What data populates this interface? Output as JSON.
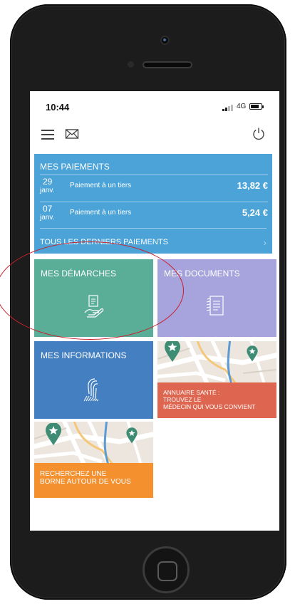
{
  "status_bar": {
    "time": "10:44",
    "network": "4G"
  },
  "payments": {
    "title": "MES PAIEMENTS",
    "items": [
      {
        "day": "29",
        "month": "janv.",
        "label": "Paiement à un tiers",
        "amount": "13,82 €"
      },
      {
        "day": "07",
        "month": "janv.",
        "label": "Paiement à un tiers",
        "amount": "5,24 €"
      }
    ],
    "all_label": "TOUS LES DERNIERS PAIEMENTS"
  },
  "tiles": {
    "demarches": "MES DÉMARCHES",
    "documents": "MES DOCUMENTS",
    "informations": "MES INFORMATIONS",
    "annuaire": [
      "ANNUAIRE SANTÉ :",
      "TROUVEZ LE",
      "MÉDECIN QUI VOUS CONVIENT"
    ],
    "borne": [
      "RECHERCHEZ UNE",
      "BORNE AUTOUR DE VOUS"
    ]
  },
  "icons": {
    "menu": "hamburger-icon",
    "mail": "envelope-icon",
    "power": "power-icon",
    "chevron": "chevron-right-icon",
    "demarches": "hand-document-icon",
    "documents": "documents-icon",
    "informations": "fingerprint-icon",
    "map_pin": "map-pin-star-icon"
  },
  "colors": {
    "payments": "#4ba3d8",
    "demarches": "#5aae98",
    "documents": "#a7a3dc",
    "informations": "#4480c1",
    "annuaire": "#de6650",
    "borne": "#f5902f",
    "annotation": "#c8202a"
  }
}
